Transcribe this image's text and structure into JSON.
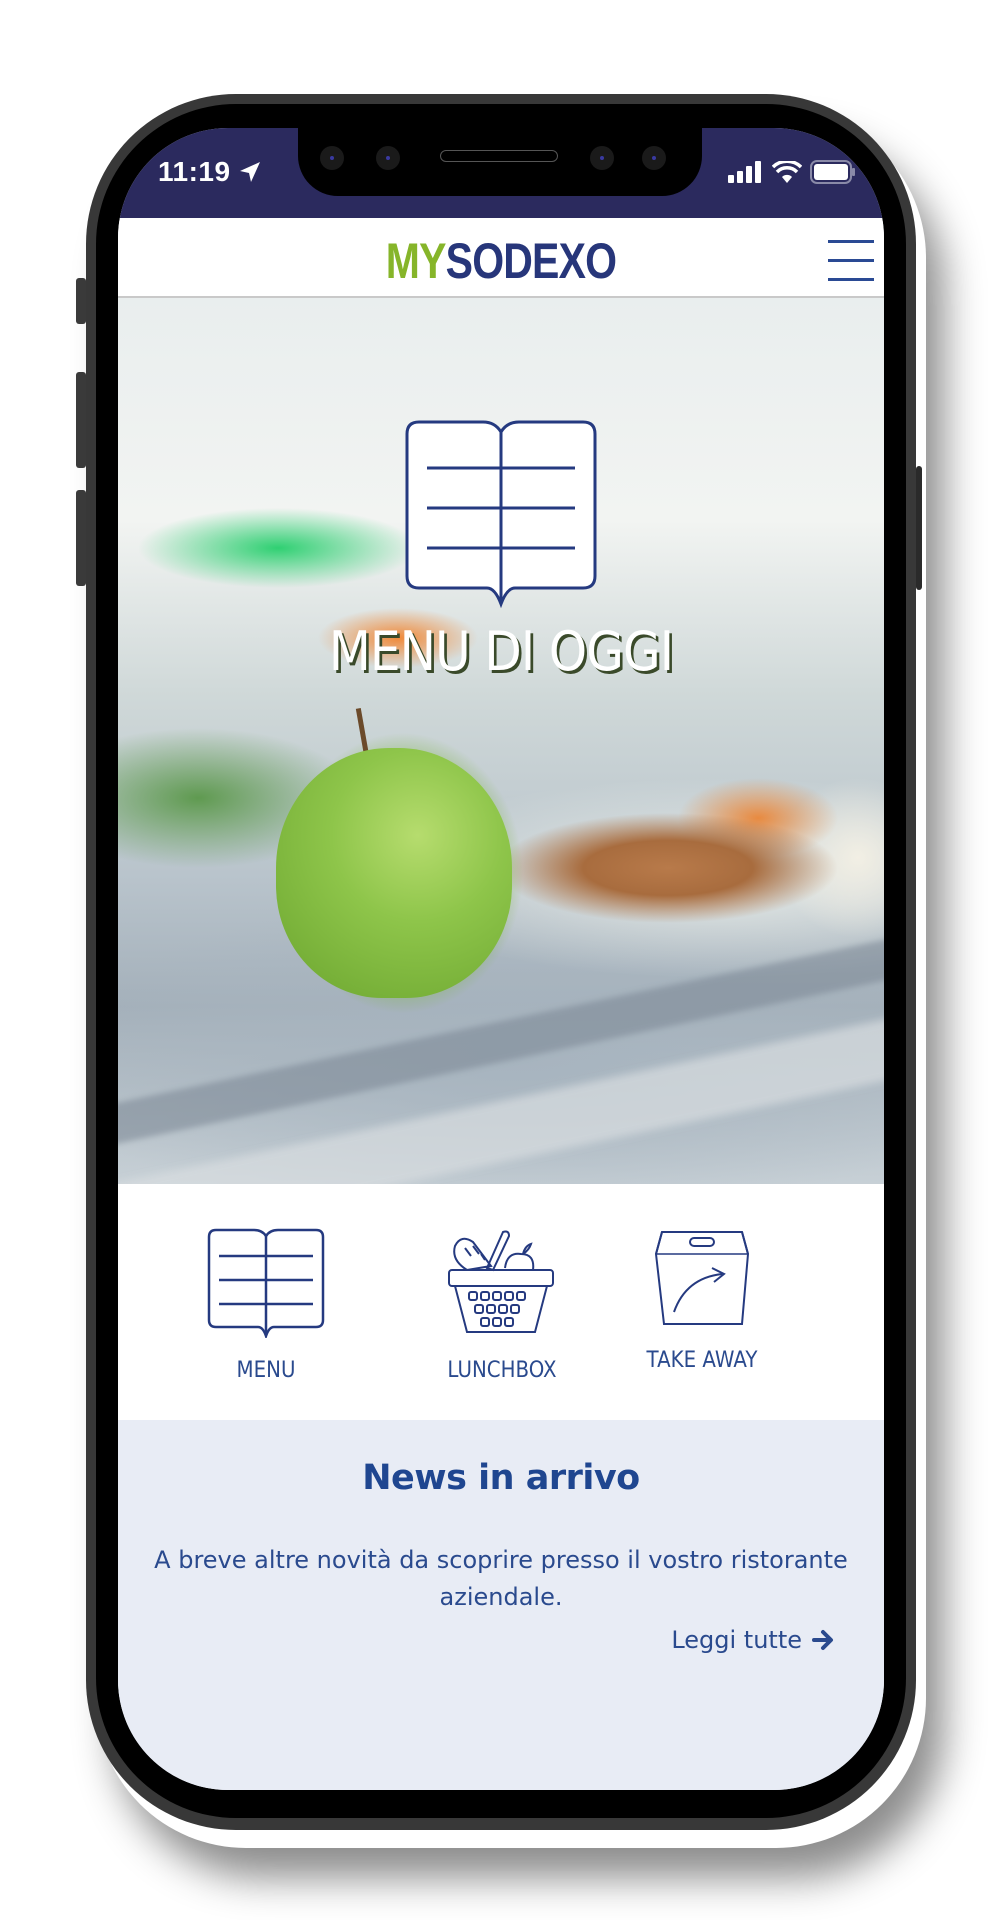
{
  "status_bar": {
    "time": "11:19",
    "location_icon": "location-arrow-icon",
    "signal_icon": "cellular-signal-icon",
    "wifi_icon": "wifi-icon",
    "battery_icon": "battery-icon"
  },
  "header": {
    "logo_prefix": "MY",
    "logo_main": "SODEXO",
    "menu_icon": "hamburger-menu-icon"
  },
  "hero": {
    "icon": "open-book-menu-icon",
    "title": "MENU DI OGGI"
  },
  "quick_links": [
    {
      "label": "MENU",
      "icon": "open-book-icon"
    },
    {
      "label": "LUNCHBOX",
      "icon": "picnic-basket-icon"
    },
    {
      "label": "TAKE AWAY",
      "icon": "takeaway-box-icon"
    }
  ],
  "news": {
    "title": "News in arrivo",
    "body": "A breve altre novità da scoprire presso il vostro ristorante aziendale.",
    "link_label": "Leggi tutte",
    "link_icon": "arrow-right-icon"
  },
  "colors": {
    "status_bar_bg": "#2b2a5e",
    "brand_green": "#86b52a",
    "brand_blue": "#27367a",
    "text_blue": "#2a4a8e",
    "news_bg": "#e8ecf5"
  }
}
